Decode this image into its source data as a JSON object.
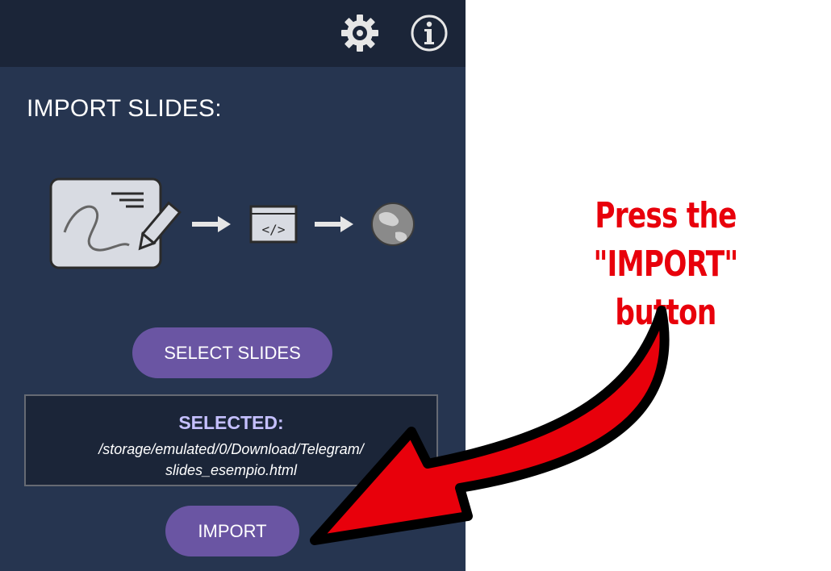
{
  "toolbar": {
    "settings_icon": "gear-icon",
    "info_icon": "info-icon"
  },
  "main": {
    "title": "IMPORT SLIDES:",
    "select_button_label": "SELECT SLIDES",
    "selected": {
      "label": "SELECTED:",
      "path_line1": "/storage/emulated/0/Download/Telegram/",
      "path_line2": "slides_esempio.html"
    },
    "import_button_label": "IMPORT"
  },
  "annotation": {
    "line1": "Press the \"IMPORT\"",
    "line2": "button",
    "color": "#e8000b"
  },
  "colors": {
    "panel_bg": "#263550",
    "topbar_bg": "#1b2538",
    "button_bg": "#6a55a3",
    "selected_label": "#c5c0ff"
  }
}
